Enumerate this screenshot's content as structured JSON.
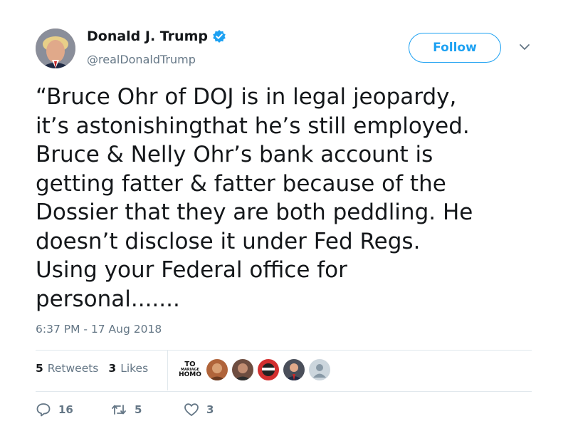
{
  "author": {
    "display_name": "Donald J. Trump",
    "handle": "@realDonaldTrump",
    "verified": true
  },
  "follow_label": "Follow",
  "tweet": {
    "text": "“Bruce Ohr of DOJ is in legal jeopardy,\nit’s astonishingthat he’s still employed.\nBruce & Nelly Ohr’s bank account is\ngetting fatter & fatter because of the\nDossier that they are both peddling. He\ndoesn’t disclose it under Fed Regs.\nUsing your Federal office for\npersonal.......",
    "timestamp": "6:37 PM - 17 Aug 2018"
  },
  "stats": {
    "retweets_count": "5",
    "retweets_label": "Retweets",
    "likes_count": "3",
    "likes_label": "Likes"
  },
  "liker_avatars": [
    {
      "kind": "text-image",
      "lines": [
        "TO",
        "MARIAGE",
        "HOMO"
      ]
    },
    {
      "kind": "photo"
    },
    {
      "kind": "photo"
    },
    {
      "kind": "photo"
    },
    {
      "kind": "photo"
    },
    {
      "kind": "default-avatar"
    }
  ],
  "actions": {
    "reply_count": "16",
    "retweet_count": "5",
    "like_count": "3"
  },
  "colors": {
    "accent": "#1da1f2",
    "secondary_text": "#657786",
    "divider": "#e1e8ed"
  },
  "icons": [
    "verified-badge-icon",
    "chevron-down-icon",
    "reply-icon",
    "retweet-icon",
    "heart-icon"
  ]
}
